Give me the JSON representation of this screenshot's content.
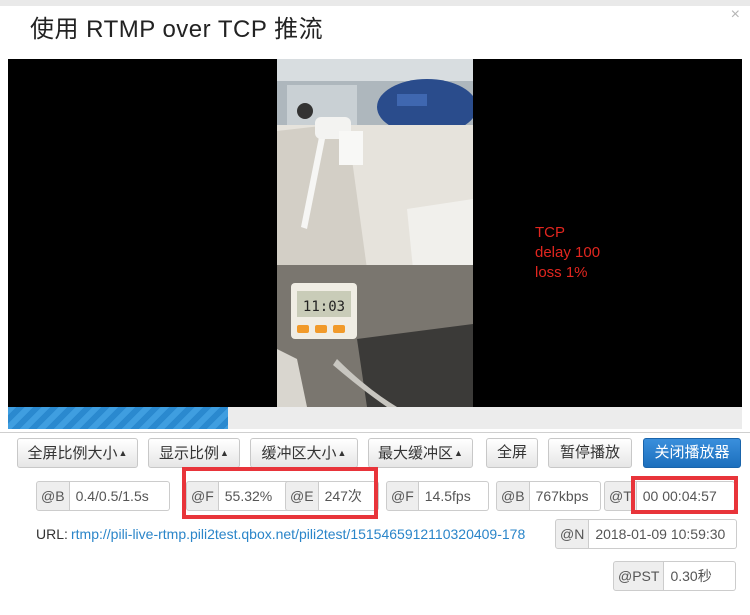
{
  "dialog": {
    "title": "使用 RTMP over TCP 推流",
    "close_glyph": "×"
  },
  "player": {
    "overlay_lines": [
      "TCP",
      "delay 100",
      "loss 1%"
    ],
    "clock_reading": "11:03",
    "progress": 0.3,
    "colors": {
      "overlay_text": "#e2261f",
      "progress_fill": "#3f9ee0",
      "primary_button": "#1c6fbd"
    }
  },
  "controls": {
    "fullscreen_ratio": "全屏比例大小",
    "display_ratio": "显示比例",
    "buffer_size": "缓冲区大小",
    "max_buffer": "最大缓冲区",
    "fullscreen": "全屏",
    "pause": "暂停播放",
    "close_player": "关闭播放器",
    "caret": "▲"
  },
  "stats": [
    {
      "label": "@B",
      "value": "0.4/0.5/1.5s"
    },
    {
      "label": "@F",
      "value": "55.32%"
    },
    {
      "label": "@E",
      "value": "247次"
    },
    {
      "label": "@F",
      "value": "14.5fps"
    },
    {
      "label": "@B",
      "value": "767kbps"
    },
    {
      "label": "@T",
      "value": "00 00:04:57"
    }
  ],
  "url": {
    "label": "URL:",
    "value": "rtmp://pili-live-rtmp.pili2test.qbox.net/pili2test/1515465912110320409-178"
  },
  "now": {
    "label": "@N",
    "value": "2018-01-09 10:59:30"
  },
  "pst": {
    "label": "@PST",
    "value": "0.30秒"
  }
}
